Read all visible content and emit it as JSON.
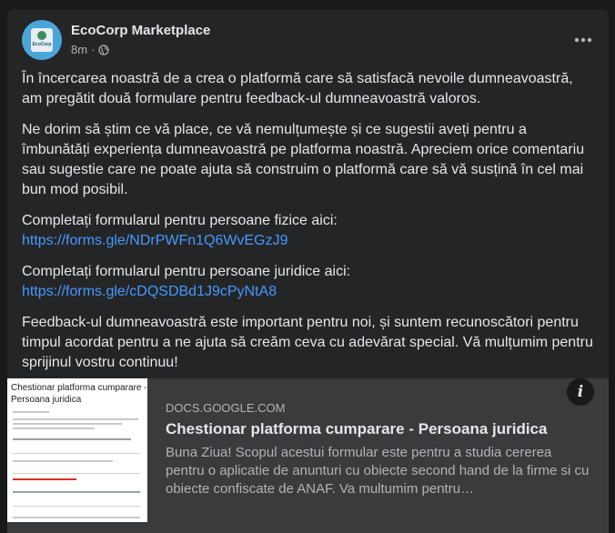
{
  "post": {
    "page_name": "EcoCorp Marketplace",
    "timestamp": "8m",
    "separator": "·",
    "privacy_icon": "globe-icon",
    "more_icon": "more-horizontal-icon",
    "avatar_logo_text": "EcoCorp",
    "paragraphs": [
      "În încercarea noastră de a crea o platformă care să satisfacă nevoile dumneavoastră, am pregătit două formulare pentru feedback-ul dumneavoastră valoros.",
      "Ne dorim să știm ce vă place, ce vă nemulțumește și ce sugestii aveți pentru a îmbunătăți experiența dumneavoastră pe platforma noastră. Apreciem orice comentariu sau sugestie care ne poate ajuta să construim o platformă care să vă susțină în cel mai bun mod posibil."
    ],
    "form_individuals_label": "Completați formularul pentru persoane fizice aici:",
    "form_individuals_link": "https://forms.gle/NDrPWFn1Q6WvEGzJ9",
    "form_companies_label": "Completați formularul pentru persoane juridice aici:",
    "form_companies_link": "https://forms.gle/cDQSDBd1J9cPyNtA8",
    "closing": "Feedback-ul dumneavoastră este important pentru noi, și suntem recunoscători pentru timpul acordat pentru a ne ajuta să creăm ceva cu adevărat special. Vă mulțumim pentru sprijinul vostru continuu!"
  },
  "link_preview": {
    "domain": "DOCS.GOOGLE.COM",
    "title": "Chestionar platforma cumparare - Persoana juridica",
    "description": "Buna Ziua! Scopul acestui formular este pentru a studia cererea pentru o aplicatie de anunturi cu obiecte second hand de la firme si cu obiecte confiscate de ANAF. Va multumim pentru…",
    "thumbnail_title": "Chestionar platforma cumparare - Persoana juridica",
    "info_icon": "info-icon",
    "info_glyph": "i"
  },
  "colors": {
    "background": "#18191a",
    "card": "#242526",
    "text": "#e4e6eb",
    "secondary_text": "#b0b3b8",
    "link": "#4599ff",
    "preview_bg": "#3a3b3c"
  }
}
